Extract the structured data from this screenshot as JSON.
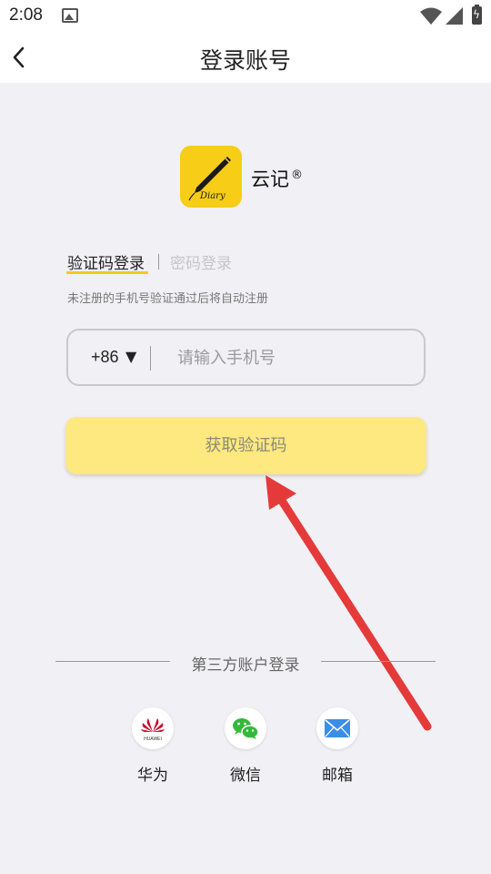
{
  "status": {
    "time": "2:08"
  },
  "nav": {
    "title": "登录账号"
  },
  "app": {
    "name": "云记",
    "reg_mark": "®",
    "logo_script": "Diary"
  },
  "tabs": [
    {
      "label": "验证码登录",
      "active": true
    },
    {
      "label": "密码登录",
      "active": false
    }
  ],
  "hint": "未注册的手机号验证通过后将自动注册",
  "phone": {
    "country_code": "+86",
    "dropdown_glyph": "▼",
    "value": "",
    "placeholder": "请输入手机号"
  },
  "code_button": {
    "label": "获取验证码"
  },
  "third_party": {
    "title": "第三方账户登录",
    "providers": [
      {
        "label": "华为",
        "icon": "huawei-icon",
        "brand_text": "HUAWEI"
      },
      {
        "label": "微信",
        "icon": "wechat-icon"
      },
      {
        "label": "邮箱",
        "icon": "mail-icon"
      }
    ]
  },
  "colors": {
    "accent": "#f5c91b",
    "logo_bg": "#f7cd17",
    "button_bg": "#fde97f",
    "annotation_arrow": "#e53a3a",
    "huawei_red": "#cf0a2c",
    "wechat_green": "#33b83a",
    "mail_blue": "#3b8ee8"
  }
}
